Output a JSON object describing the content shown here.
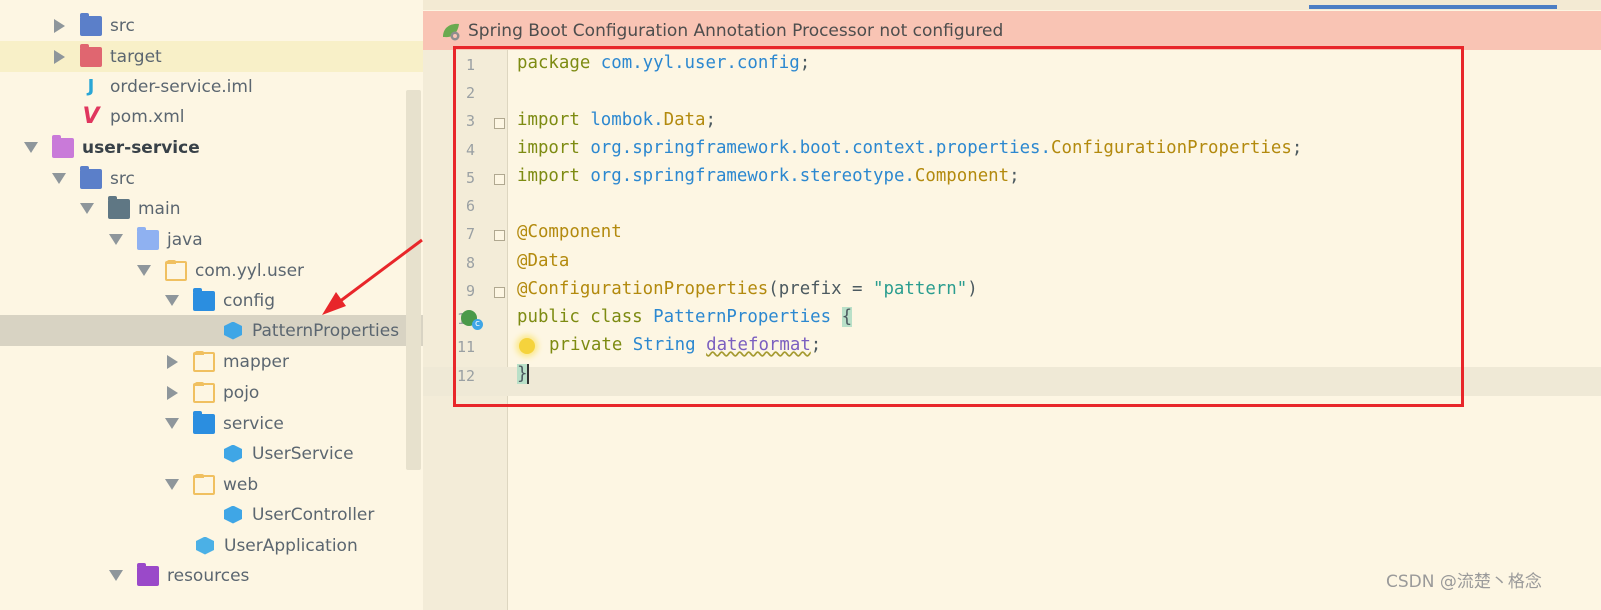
{
  "tree": {
    "items": [
      {
        "label": "src",
        "icon": "source-folder-icon",
        "state": "collapsed"
      },
      {
        "label": "target",
        "icon": "excluded-folder-icon",
        "state": "collapsed"
      },
      {
        "label": "order-service.iml",
        "icon": "iml-file-icon"
      },
      {
        "label": "pom.xml",
        "icon": "maven-pom-icon"
      },
      {
        "label": "user-service",
        "icon": "module-folder-icon",
        "state": "expanded"
      },
      {
        "label": "src",
        "icon": "source-folder-icon",
        "state": "expanded"
      },
      {
        "label": "main",
        "icon": "folder-icon",
        "state": "expanded"
      },
      {
        "label": "java",
        "icon": "java-source-root-icon",
        "state": "expanded"
      },
      {
        "label": "com.yyl.user",
        "icon": "package-icon",
        "state": "expanded"
      },
      {
        "label": "config",
        "icon": "config-package-icon",
        "state": "expanded"
      },
      {
        "label": "PatternProperties",
        "icon": "class-icon",
        "selected": true
      },
      {
        "label": "mapper",
        "icon": "package-icon",
        "state": "collapsed"
      },
      {
        "label": "pojo",
        "icon": "package-icon",
        "state": "collapsed"
      },
      {
        "label": "service",
        "icon": "service-package-icon",
        "state": "expanded"
      },
      {
        "label": "UserService",
        "icon": "class-icon"
      },
      {
        "label": "web",
        "icon": "package-icon",
        "state": "expanded"
      },
      {
        "label": "UserController",
        "icon": "class-icon"
      },
      {
        "label": "UserApplication",
        "icon": "spring-boot-class-icon"
      },
      {
        "label": "resources",
        "icon": "resources-folder-icon",
        "state": "expanded"
      }
    ]
  },
  "editor": {
    "banner_text": "Spring Boot Configuration Annotation Processor not configured",
    "line_numbers": [
      "1",
      "2",
      "3",
      "4",
      "5",
      "6",
      "7",
      "8",
      "9",
      "10",
      "11",
      "12"
    ],
    "code": {
      "l1_kw": "package",
      "l1_pkg": "com.yyl.user.config",
      "l1_end": ";",
      "l3_kw": "import",
      "l3_pkg": "lombok.",
      "l3_type": "Data",
      "l3_end": ";",
      "l4_kw": "import",
      "l4_pkg": "org.springframework.boot.context.properties.",
      "l4_type": "ConfigurationProperties",
      "l4_end": ";",
      "l5_kw": "import",
      "l5_pkg": "org.springframework.stereotype.",
      "l5_type": "Component",
      "l5_end": ";",
      "l7_ann": "@Component",
      "l8_ann": "@Data",
      "l9_ann": "@ConfigurationProperties",
      "l9_open": "(prefix = ",
      "l9_str": "\"pattern\"",
      "l9_close": ")",
      "l10_kw": "public class",
      "l10_cls": "PatternProperties",
      "l10_brace": "{",
      "l11_kw": "private",
      "l11_type": "String",
      "l11_field": "dateformat",
      "l11_end": ";",
      "l12_brace": "}"
    }
  },
  "watermark": "CSDN @流楚丶格念",
  "colors": {
    "background": "#fdf6e3",
    "banner": "#f9c4b4",
    "highlight_box": "#e8262a",
    "keyword": "#7d8b12",
    "package": "#2c88d0",
    "annotation": "#b38a0e",
    "string": "#2a9d8f"
  }
}
